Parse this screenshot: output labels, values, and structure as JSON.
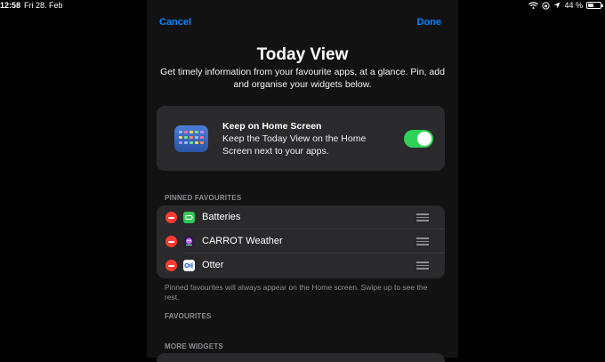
{
  "status_bar": {
    "time": "12:58",
    "date": "Fri 28. Feb",
    "battery": "44 %",
    "battery_level": 0.44,
    "icons": [
      "wifi-icon",
      "orientation-lock-icon",
      "location-icon",
      "battery-icon"
    ]
  },
  "nav": {
    "cancel": "Cancel",
    "done": "Done"
  },
  "header": {
    "title": "Today View",
    "subtitle": "Get timely information from your favourite apps, at a glance. Pin, add and organise your widgets below."
  },
  "home_screen": {
    "title": "Keep on Home Screen",
    "description": "Keep the Today View on the Home Screen next to your apps.",
    "enabled": true
  },
  "sections": {
    "pinned": "PINNED FAVOURITES",
    "favourites": "FAVOURITES",
    "more": "MORE WIDGETS"
  },
  "pinned": [
    {
      "label": "Batteries",
      "icon": "batteries-icon"
    },
    {
      "label": "CARROT Weather",
      "icon": "carrot-weather-icon"
    },
    {
      "label": "Otter",
      "icon": "otter-icon"
    }
  ],
  "pinned_note": "Pinned favourites will always appear on the Home screen. Swipe up to see the rest.",
  "colors": {
    "accent": "#0a84ff",
    "toggle_on": "#30d158",
    "remove": "#ff3b30",
    "card": "#2a2a2c",
    "sheet": "#121212"
  }
}
